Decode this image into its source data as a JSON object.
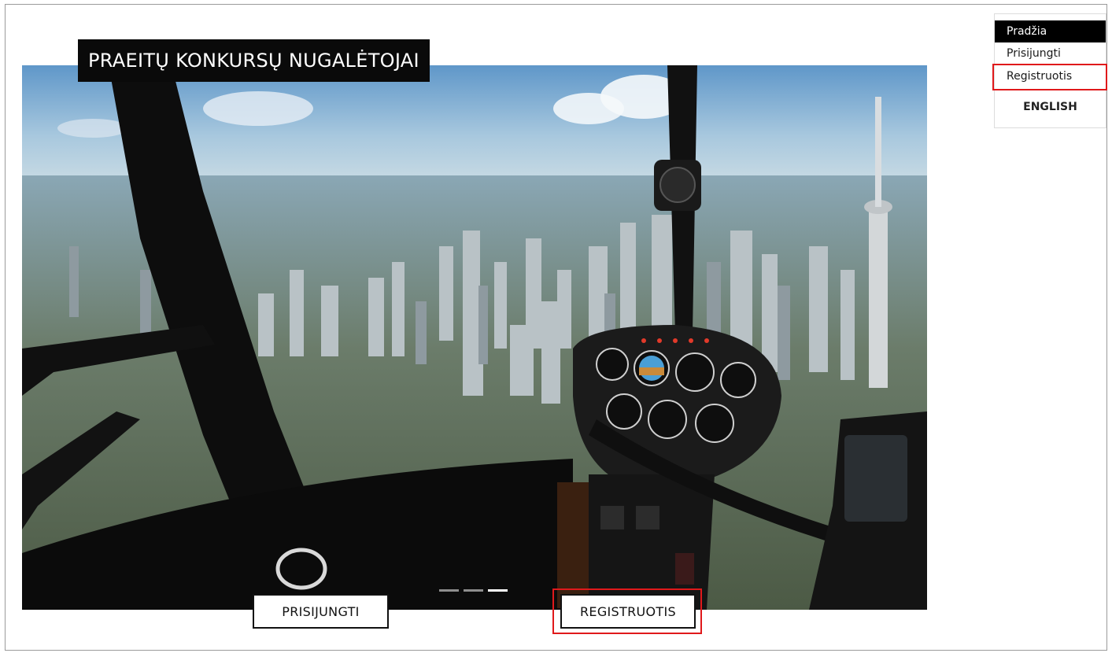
{
  "hero": {
    "title": "PRAEITŲ KONKURSŲ NUGALĖTOJAI",
    "scene": "helicopter-cockpit-over-city-photo",
    "slides_total": 3,
    "active_slide": 3
  },
  "buttons": {
    "login": "PRISIJUNGTI",
    "register": "REGISTRUOTIS"
  },
  "menu": {
    "items": [
      {
        "label": "Pradžia",
        "active": true
      },
      {
        "label": "Prisijungti",
        "active": false
      },
      {
        "label": "Registruotis",
        "active": false
      }
    ],
    "language": "ENGLISH"
  },
  "colors": {
    "highlight": "#e0191b",
    "banner_bg": "#0a0a0a",
    "active_menu_bg": "#000000"
  }
}
